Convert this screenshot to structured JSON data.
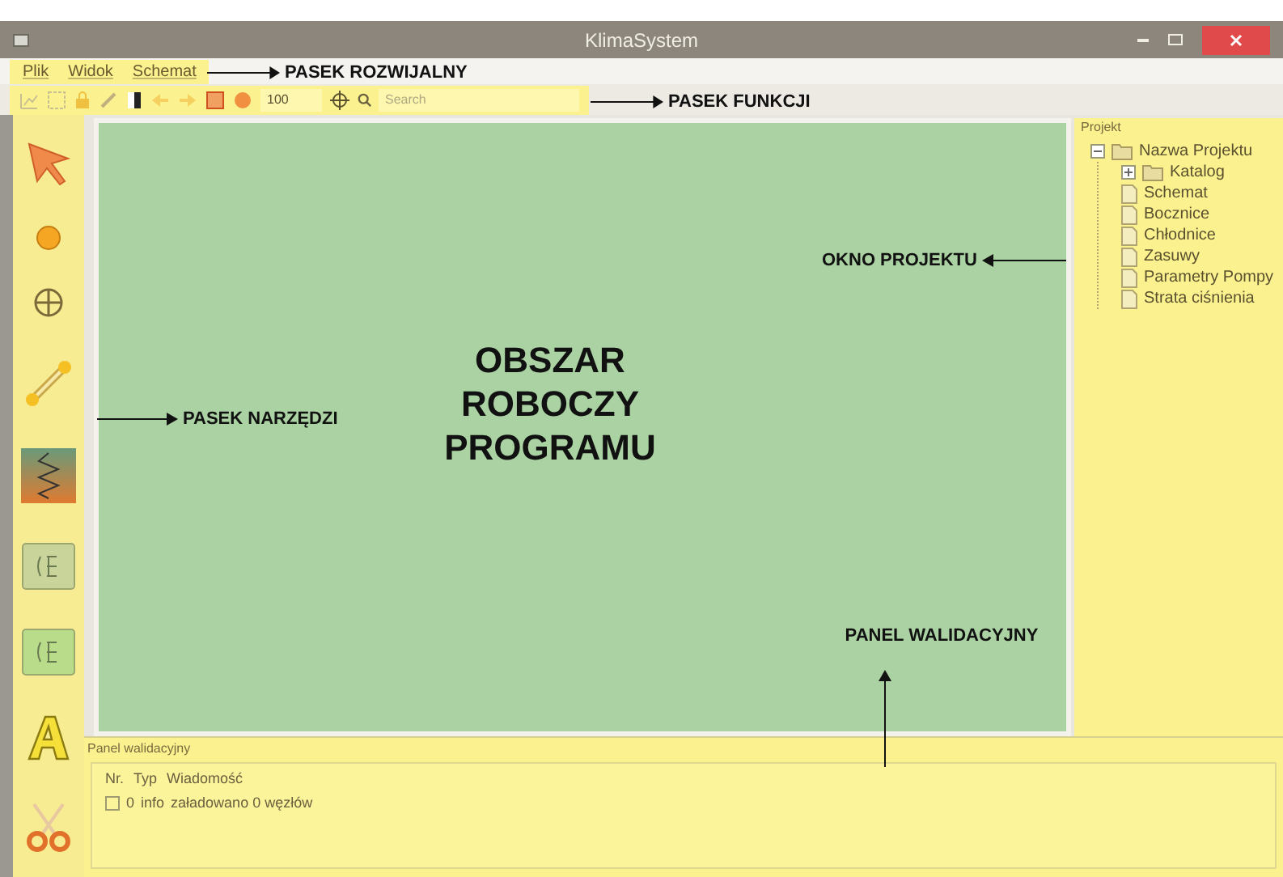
{
  "window": {
    "title": "KlimaSystem"
  },
  "menu": [
    "Plik",
    "Widok",
    "Schemat"
  ],
  "toolbar": {
    "zoom": "100",
    "search": {
      "placeholder": "Search"
    }
  },
  "tools": [
    {
      "kind": "pointer"
    },
    {
      "kind": "node"
    },
    {
      "kind": "pump"
    },
    {
      "kind": "pipe"
    },
    {
      "kind": "heater"
    },
    {
      "kind": "valve"
    },
    {
      "kind": "valve2"
    },
    {
      "kind": "text"
    },
    {
      "kind": "cut"
    }
  ],
  "canvas": {
    "label": "OBSZAR\nROBOCZY\nPROGRAMU"
  },
  "project": {
    "title": "Projekt",
    "tree": [
      {
        "label": "Nazwa Projektu",
        "kind": "folder",
        "expanded": true,
        "children": [
          {
            "label": "Katalog",
            "kind": "folder",
            "expanded": false
          },
          {
            "label": "Schemat",
            "kind": "file"
          },
          {
            "label": "Bocznice",
            "kind": "file"
          },
          {
            "label": "Chłodnice",
            "kind": "file"
          },
          {
            "label": "Zasuwy",
            "kind": "file"
          },
          {
            "label": "Parametry Pompy",
            "kind": "file"
          },
          {
            "label": "Strata ciśnienia",
            "kind": "file"
          }
        ]
      }
    ]
  },
  "validation": {
    "title": "Panel walidacyjny",
    "columns": [
      "Nr.",
      "Typ",
      "Wiadomość"
    ],
    "rows": [
      {
        "checked": false,
        "nr": "0",
        "type": "info",
        "message": "załadowano 0 węzłów"
      }
    ]
  },
  "annotations": [
    {
      "label": "PASEK ROZWIJALNY",
      "kind": "arrow-before"
    },
    {
      "label": "PASEK FUNKCJI",
      "kind": "arrow-before"
    },
    {
      "label": "OKNO PROJEKTU",
      "kind": "arrow-after"
    },
    {
      "label": "PASEK NARZĘDZI",
      "kind": "arrow-before"
    },
    {
      "label": "PANEL WALIDACYJNY",
      "kind": "arrow-below"
    }
  ]
}
